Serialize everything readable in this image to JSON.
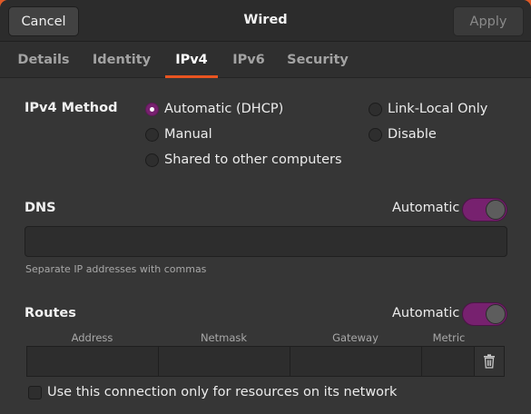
{
  "header": {
    "cancel_label": "Cancel",
    "title": "Wired",
    "apply_label": "Apply"
  },
  "tabs": [
    {
      "label": "Details",
      "active": false
    },
    {
      "label": "Identity",
      "active": false
    },
    {
      "label": "IPv4",
      "active": true
    },
    {
      "label": "IPv6",
      "active": false
    },
    {
      "label": "Security",
      "active": false
    }
  ],
  "ipv4_method": {
    "label": "IPv4 Method",
    "options": [
      {
        "label": "Automatic (DHCP)",
        "selected": true
      },
      {
        "label": "Manual",
        "selected": false
      },
      {
        "label": "Shared to other computers",
        "selected": false
      },
      {
        "label": "Link-Local Only",
        "selected": false
      },
      {
        "label": "Disable",
        "selected": false
      }
    ]
  },
  "dns": {
    "label": "DNS",
    "automatic_label": "Automatic",
    "automatic_on": true,
    "value": "",
    "hint": "Separate IP addresses with commas"
  },
  "routes": {
    "label": "Routes",
    "automatic_label": "Automatic",
    "automatic_on": true,
    "columns": [
      "Address",
      "Netmask",
      "Gateway",
      "Metric"
    ],
    "row": {
      "address": "",
      "netmask": "",
      "gateway": "",
      "metric": ""
    }
  },
  "restrict_checkbox": {
    "label": "Use this connection only for resources on its network",
    "checked": false
  },
  "colors": {
    "accent": "#77216f",
    "tab_underline": "#e95420"
  }
}
